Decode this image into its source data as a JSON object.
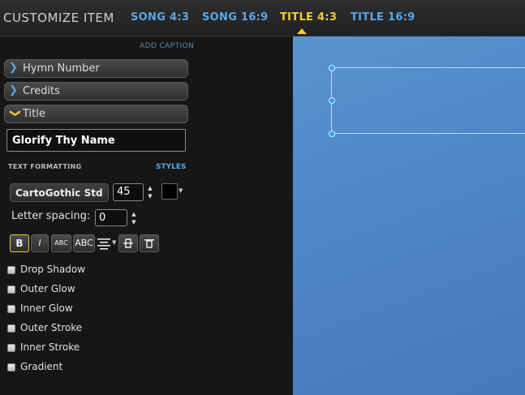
{
  "header": {
    "title": "CUSTOMIZE ITEM",
    "tabs": [
      {
        "label": "SONG 4:3",
        "active": false
      },
      {
        "label": "SONG 16:9",
        "active": false
      },
      {
        "label": "TITLE 4:3",
        "active": true
      },
      {
        "label": "TITLE 16:9",
        "active": false
      }
    ]
  },
  "panel": {
    "add_caption": "ADD CAPTION",
    "sections": [
      {
        "label": "Hymn Number",
        "expanded": false
      },
      {
        "label": "Credits",
        "expanded": false
      },
      {
        "label": "Title",
        "expanded": true
      }
    ],
    "title_value": "Glorify Thy Name",
    "text_formatting_label": "TEXT FORMATTING",
    "styles_label": "STYLES",
    "font_family": "CartoGothic Std",
    "font_size": "45",
    "text_color": "#000000",
    "letter_spacing_label": "Letter spacing:",
    "letter_spacing_value": "0",
    "format_buttons": {
      "bold": "B",
      "italic": "I",
      "small_caps": "ABC",
      "all_caps": "ABC"
    },
    "effects": [
      {
        "label": "Drop Shadow",
        "checked": false
      },
      {
        "label": "Outer Glow",
        "checked": false
      },
      {
        "label": "Inner Glow",
        "checked": false
      },
      {
        "label": "Outer Stroke",
        "checked": false
      },
      {
        "label": "Inner Stroke",
        "checked": false
      },
      {
        "label": "Gradient",
        "checked": false
      }
    ]
  },
  "colors": {
    "accent_yellow": "#f2cf2e",
    "accent_blue": "#5aa6e8",
    "canvas_blue": "#4f88c8"
  },
  "icons": {
    "chevron_collapsed": "chevron-right-icon",
    "chevron_expanded": "chevron-down-icon",
    "align": "align-center-icon",
    "valign_middle": "vertical-align-icon",
    "valign_top": "top-align-icon"
  }
}
